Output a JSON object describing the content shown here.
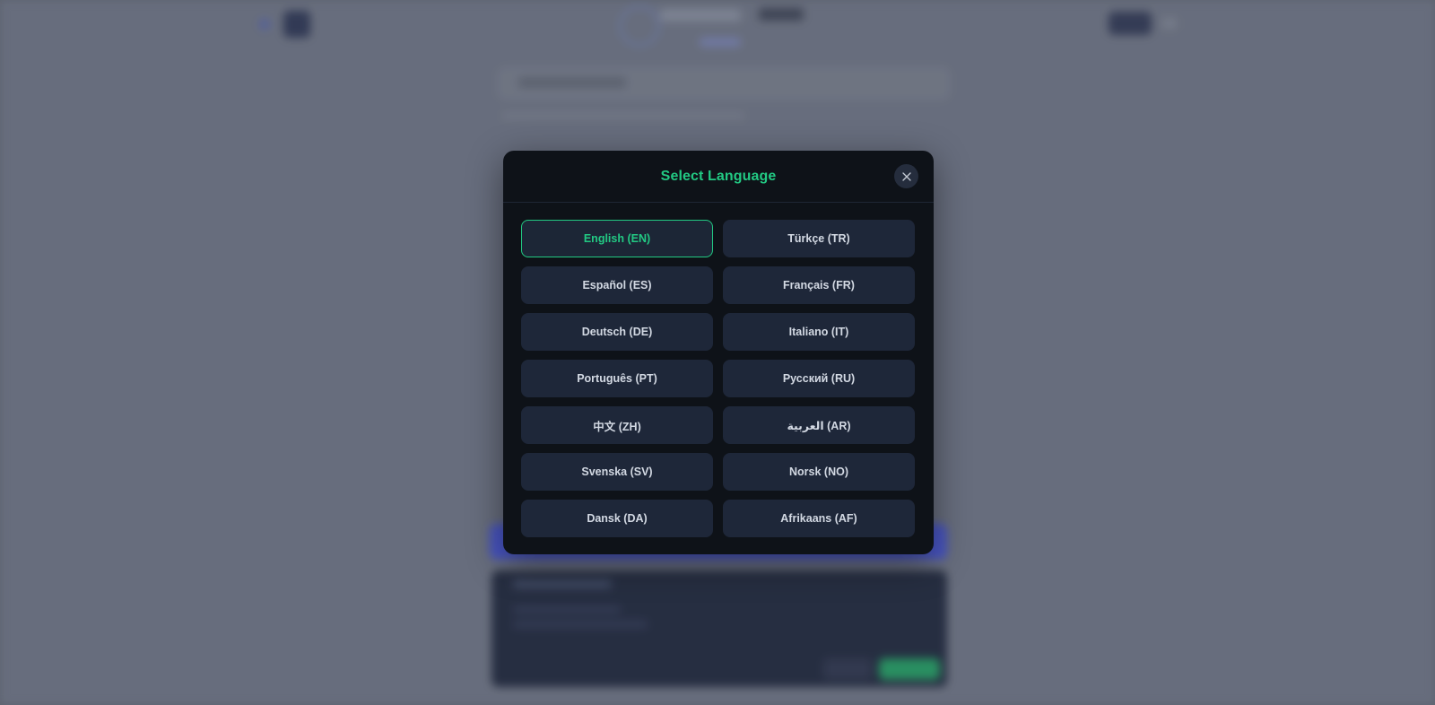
{
  "modal": {
    "title": "Select Language",
    "close_icon": "close-icon",
    "selected_code": "EN",
    "languages": [
      {
        "label": "English (EN)",
        "code": "EN"
      },
      {
        "label": "Türkçe (TR)",
        "code": "TR"
      },
      {
        "label": "Español (ES)",
        "code": "ES"
      },
      {
        "label": "Français (FR)",
        "code": "FR"
      },
      {
        "label": "Deutsch (DE)",
        "code": "DE"
      },
      {
        "label": "Italiano (IT)",
        "code": "IT"
      },
      {
        "label": "Português (PT)",
        "code": "PT"
      },
      {
        "label": "Русский (RU)",
        "code": "RU"
      },
      {
        "label": "中文 (ZH)",
        "code": "ZH"
      },
      {
        "label": "العربية (AR)",
        "code": "AR"
      },
      {
        "label": "Svenska (SV)",
        "code": "SV"
      },
      {
        "label": "Norsk (NO)",
        "code": "NO"
      },
      {
        "label": "Dansk (DA)",
        "code": "DA"
      },
      {
        "label": "Afrikaans (AF)",
        "code": "AF"
      }
    ]
  },
  "colors": {
    "accent": "#22c983",
    "modal_bg": "#0e1218",
    "button_bg": "#1e2739",
    "button_text": "#d3d9e3"
  }
}
